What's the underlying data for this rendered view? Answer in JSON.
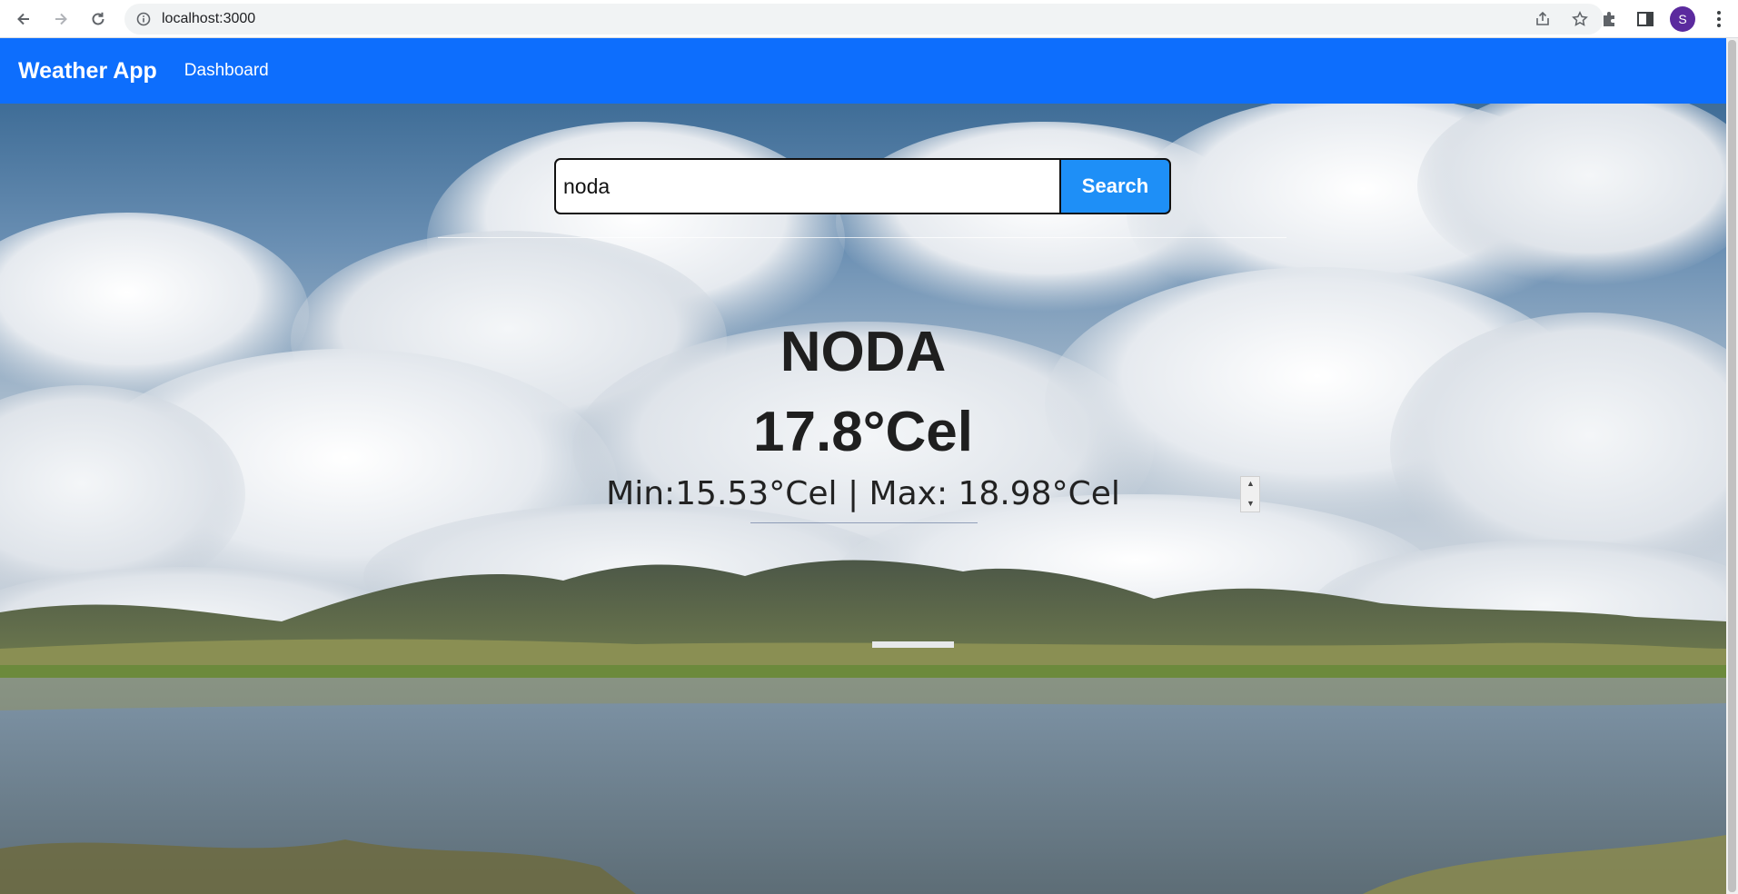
{
  "browser": {
    "url": "localhost:3000",
    "profile_initial": "S"
  },
  "navbar": {
    "brand": "Weather App",
    "links": [
      "Dashboard"
    ],
    "color": "#0d6efd"
  },
  "search": {
    "value": "noda",
    "button_label": "Search",
    "button_color": "#1e8ff7"
  },
  "weather": {
    "city": "NODA",
    "temperature": "17.8°Cel",
    "min_max": "Min:15.53°Cel | Max: 18.98°Cel"
  },
  "icons": {
    "back": "arrow-left-icon",
    "forward": "arrow-right-icon",
    "reload": "reload-icon",
    "info": "info-icon",
    "share": "share-icon",
    "bookmark": "star-icon",
    "extensions": "puzzle-icon",
    "side_panel": "side-panel-icon",
    "menu": "kebab-menu-icon"
  }
}
